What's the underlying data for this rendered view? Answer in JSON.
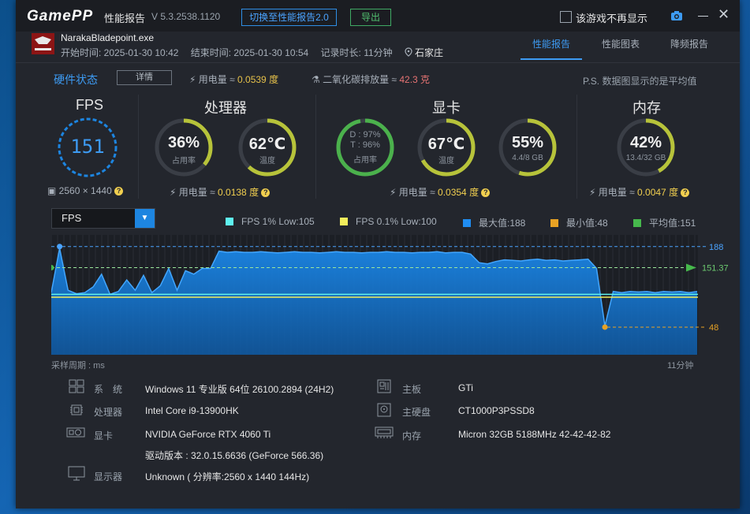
{
  "app": {
    "logo": "GamePP",
    "title": "性能报告",
    "version": "V 5.3.2538.1120",
    "switch_label": "切换至性能报告2.0",
    "export_label": "导出",
    "no_show_label": "该游戏不再显示"
  },
  "game": {
    "name": "NarakaBladepoint.exe",
    "start": "开始时间: 2025-01-30 10:42",
    "end": "结束时间: 2025-01-30 10:54",
    "duration": "记录时长: 11分钟",
    "location": "石家庄"
  },
  "tabs": [
    "性能报告",
    "性能图表",
    "降频报告"
  ],
  "hw": {
    "title": "硬件状态",
    "detail_label": "详情",
    "power_label": "用电量 ≈ ",
    "power_value": "0.0539 度",
    "co2_label": "二氧化碳排放量 ≈ ",
    "co2_value": "42.3 克",
    "ps": "P.S. 数据图显示的是平均值"
  },
  "fps": {
    "title": "FPS",
    "value": "151",
    "resolution": "2560 × 1440"
  },
  "cpu": {
    "title": "处理器",
    "usage": "36%",
    "usage_label": "占用率",
    "usage_frac": 0.36,
    "temp": "62℃",
    "temp_label": "温度",
    "temp_frac": 0.62,
    "power_label": "用电量 ≈ ",
    "power_value": "0.0138 度"
  },
  "gpu": {
    "title": "显卡",
    "d": "D : 97%",
    "t": "T : 96%",
    "usage_label": "占用率",
    "usage_frac": 0.97,
    "temp": "67℃",
    "temp_label": "温度",
    "temp_frac": 0.67,
    "vram": "55%",
    "vram_sub": "4.4/8 GB",
    "vram_frac": 0.55,
    "power_label": "用电量 ≈ ",
    "power_value": "0.0354 度"
  },
  "mem": {
    "title": "内存",
    "value": "42%",
    "sub": "13.4/32 GB",
    "frac": 0.42,
    "power_label": "用电量 ≈ ",
    "power_value": "0.0047 度"
  },
  "graph": {
    "select": "FPS",
    "legend": [
      {
        "label": "FPS 1% Low:105",
        "color": "#5ef2f0"
      },
      {
        "label": "FPS 0.1% Low:100",
        "color": "#f3ee5b"
      },
      {
        "label": "最大值:188",
        "color": "#1f8df2"
      },
      {
        "label": "最小值:48",
        "color": "#e8a224"
      },
      {
        "label": "平均值:151",
        "color": "#46b94c"
      }
    ],
    "max_label": "188",
    "avg_label": "151.37",
    "min_label": "48",
    "x_left": "采样周期 : ms",
    "x_right": "11分钟"
  },
  "chart_data": {
    "type": "area",
    "ylim": [
      0,
      200
    ],
    "max": 188,
    "min": 48,
    "avg": 151.37,
    "low1": 105,
    "low01": 100,
    "values": [
      108,
      185,
      112,
      106,
      108,
      118,
      140,
      105,
      110,
      130,
      112,
      138,
      108,
      120,
      150,
      112,
      146,
      140,
      150,
      150,
      180,
      178,
      179,
      178,
      178,
      179,
      178,
      177,
      178,
      179,
      178,
      178,
      177,
      178,
      179,
      178,
      178,
      177,
      178,
      178,
      179,
      178,
      178,
      177,
      178,
      178,
      179,
      177,
      178,
      178,
      175,
      160,
      158,
      162,
      165,
      164,
      163,
      165,
      166,
      164,
      165,
      163,
      164,
      165,
      166,
      150,
      50,
      110,
      108,
      110,
      109,
      110,
      108,
      110,
      109,
      110,
      108,
      110
    ]
  },
  "sysinfo": [
    {
      "label": "系　统",
      "value": "Windows 11 专业版 64位 26100.2894 (24H2)",
      "icon": "windows-icon"
    },
    {
      "label": "处理器",
      "value": "Intel Core i9-13900HK",
      "icon": "cpu-icon"
    },
    {
      "label": "显卡",
      "value": "NVIDIA GeForce RTX 4060 Ti",
      "icon": "gpu-icon"
    },
    {
      "label": "",
      "value": "驱动版本 : 32.0.15.6636 (GeForce 566.36)",
      "icon": ""
    },
    {
      "label": "显示器",
      "value": "Unknown ( 分辨率:2560 x 1440 144Hz)",
      "icon": "monitor-icon"
    },
    {
      "label": "主板",
      "value": "GTi",
      "icon": "motherboard-icon"
    },
    {
      "label": "主硬盘",
      "value": "CT1000P3PSSD8",
      "icon": "disk-icon"
    },
    {
      "label": "内存",
      "value": "Micron 32GB 5188MHz 42-42-42-82",
      "icon": "ram-icon"
    }
  ]
}
